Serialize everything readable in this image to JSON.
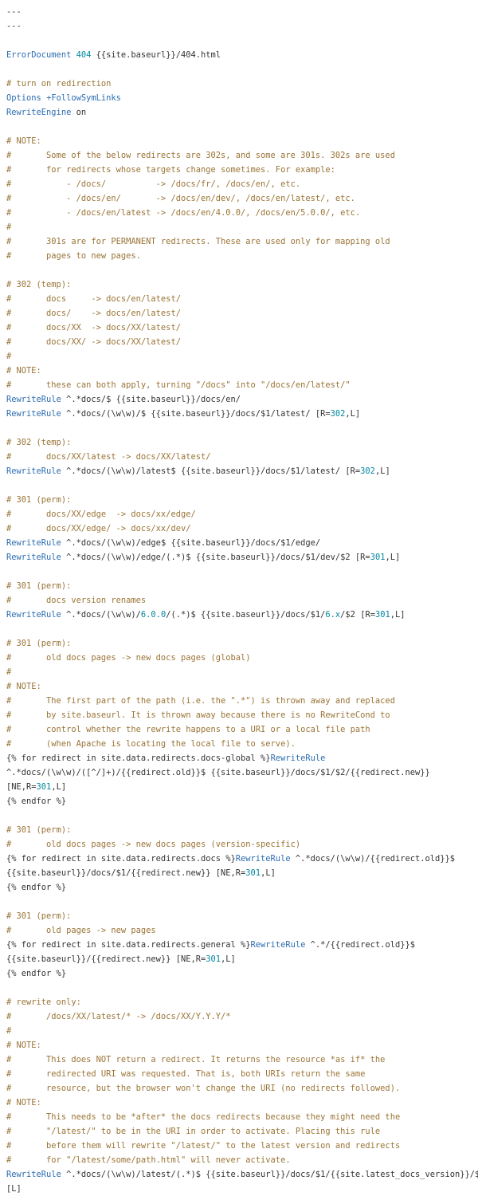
{
  "colors": {
    "background": "#ffffff",
    "plain": "#333333",
    "comment": "#9a7436",
    "keyword": "#2b6cb0",
    "number": "#00869e"
  },
  "lines": [
    [
      [
        "plain",
        "---"
      ]
    ],
    [
      [
        "plain",
        "---"
      ]
    ],
    [],
    [
      [
        "kw",
        "ErrorDocument"
      ],
      [
        "plain",
        " "
      ],
      [
        "num",
        "404"
      ],
      [
        "plain",
        " {{site.baseurl}}/404.html"
      ]
    ],
    [],
    [
      [
        "comment",
        "# turn on redirection"
      ]
    ],
    [
      [
        "kw",
        "Options"
      ],
      [
        "plain",
        " "
      ],
      [
        "kw",
        "+FollowSymLinks"
      ]
    ],
    [
      [
        "kw",
        "RewriteEngine"
      ],
      [
        "plain",
        " on"
      ]
    ],
    [],
    [
      [
        "comment",
        "# NOTE:"
      ]
    ],
    [
      [
        "comment",
        "#       Some of the below redirects are 302s, and some are 301s. 302s are used"
      ]
    ],
    [
      [
        "comment",
        "#       for redirects whose targets change sometimes. For example:"
      ]
    ],
    [
      [
        "comment",
        "#           - /docs/          -> /docs/fr/, /docs/en/, etc."
      ]
    ],
    [
      [
        "comment",
        "#           - /docs/en/       -> /docs/en/dev/, /docs/en/latest/, etc."
      ]
    ],
    [
      [
        "comment",
        "#           - /docs/en/latest -> /docs/en/4.0.0/, /docs/en/5.0.0/, etc."
      ]
    ],
    [
      [
        "comment",
        "#"
      ]
    ],
    [
      [
        "comment",
        "#       301s are for PERMANENT redirects. These are used only for mapping old"
      ]
    ],
    [
      [
        "comment",
        "#       pages to new pages."
      ]
    ],
    [],
    [
      [
        "comment",
        "# 302 (temp):"
      ]
    ],
    [
      [
        "comment",
        "#       docs     -> docs/en/latest/"
      ]
    ],
    [
      [
        "comment",
        "#       docs/    -> docs/en/latest/"
      ]
    ],
    [
      [
        "comment",
        "#       docs/XX  -> docs/XX/latest/"
      ]
    ],
    [
      [
        "comment",
        "#       docs/XX/ -> docs/XX/latest/"
      ]
    ],
    [
      [
        "comment",
        "#"
      ]
    ],
    [
      [
        "comment",
        "# NOTE:"
      ]
    ],
    [
      [
        "comment",
        "#       these can both apply, turning \"/docs\" into \"/docs/en/latest/\""
      ]
    ],
    [
      [
        "kw",
        "RewriteRule"
      ],
      [
        "plain",
        " ^.*docs/$ {{site.baseurl}}/docs/en/"
      ]
    ],
    [
      [
        "kw",
        "RewriteRule"
      ],
      [
        "plain",
        " ^.*docs/(\\w\\w)/$ {{site.baseurl}}/docs/$1/latest/ [R="
      ],
      [
        "num",
        "302"
      ],
      [
        "plain",
        ",L]"
      ]
    ],
    [],
    [
      [
        "comment",
        "# 302 (temp):"
      ]
    ],
    [
      [
        "comment",
        "#       docs/XX/latest -> docs/XX/latest/"
      ]
    ],
    [
      [
        "kw",
        "RewriteRule"
      ],
      [
        "plain",
        " ^.*docs/(\\w\\w)/latest$ {{site.baseurl}}/docs/$1/latest/ [R="
      ],
      [
        "num",
        "302"
      ],
      [
        "plain",
        ",L]"
      ]
    ],
    [],
    [
      [
        "comment",
        "# 301 (perm):"
      ]
    ],
    [
      [
        "comment",
        "#       docs/XX/edge  -> docs/xx/edge/"
      ]
    ],
    [
      [
        "comment",
        "#       docs/XX/edge/ -> docs/xx/dev/"
      ]
    ],
    [
      [
        "kw",
        "RewriteRule"
      ],
      [
        "plain",
        " ^.*docs/(\\w\\w)/edge$ {{site.baseurl}}/docs/$1/edge/"
      ]
    ],
    [
      [
        "kw",
        "RewriteRule"
      ],
      [
        "plain",
        " ^.*docs/(\\w\\w)/edge/(.*)$ {{site.baseurl}}/docs/$1/dev/$2 [R="
      ],
      [
        "num",
        "301"
      ],
      [
        "plain",
        ",L]"
      ]
    ],
    [],
    [
      [
        "comment",
        "# 301 (perm):"
      ]
    ],
    [
      [
        "comment",
        "#       docs version renames"
      ]
    ],
    [
      [
        "kw",
        "RewriteRule"
      ],
      [
        "plain",
        " ^.*docs/(\\w\\w)/"
      ],
      [
        "num",
        "6.0.0"
      ],
      [
        "plain",
        "/(.*)$ {{site.baseurl}}/docs/$1/"
      ],
      [
        "num",
        "6.x"
      ],
      [
        "plain",
        "/$2 [R="
      ],
      [
        "num",
        "301"
      ],
      [
        "plain",
        ",L]"
      ]
    ],
    [],
    [
      [
        "comment",
        "# 301 (perm):"
      ]
    ],
    [
      [
        "comment",
        "#       old docs pages -> new docs pages (global)"
      ]
    ],
    [
      [
        "comment",
        "#"
      ]
    ],
    [
      [
        "comment",
        "# NOTE:"
      ]
    ],
    [
      [
        "comment",
        "#       The first part of the path (i.e. the \".*\") is thrown away and replaced"
      ]
    ],
    [
      [
        "comment",
        "#       by site.baseurl. It is thrown away because there is no RewriteCond to"
      ]
    ],
    [
      [
        "comment",
        "#       control whether the rewrite happens to a URI or a local file path"
      ]
    ],
    [
      [
        "comment",
        "#       (when Apache is locating the local file to serve)."
      ]
    ],
    [
      [
        "plain",
        "{% for redirect in site.data.redirects.docs-global %}"
      ],
      [
        "kw",
        "RewriteRule"
      ]
    ],
    [
      [
        "plain",
        "^.*docs/(\\w\\w)/([^/]+)/{{redirect.old}}$ {{site.baseurl}}/docs/$1/$2/{{redirect.new}}"
      ]
    ],
    [
      [
        "plain",
        "[NE,R="
      ],
      [
        "num",
        "301"
      ],
      [
        "plain",
        ",L]"
      ]
    ],
    [
      [
        "plain",
        "{% endfor %}"
      ]
    ],
    [],
    [
      [
        "comment",
        "# 301 (perm):"
      ]
    ],
    [
      [
        "comment",
        "#       old docs pages -> new docs pages (version-specific)"
      ]
    ],
    [
      [
        "plain",
        "{% for redirect in site.data.redirects.docs %}"
      ],
      [
        "kw",
        "RewriteRule"
      ],
      [
        "plain",
        " ^.*docs/(\\w\\w)/{{redirect.old}}$"
      ]
    ],
    [
      [
        "plain",
        "{{site.baseurl}}/docs/$1/{{redirect.new}} [NE,R="
      ],
      [
        "num",
        "301"
      ],
      [
        "plain",
        ",L]"
      ]
    ],
    [
      [
        "plain",
        "{% endfor %}"
      ]
    ],
    [],
    [
      [
        "comment",
        "# 301 (perm):"
      ]
    ],
    [
      [
        "comment",
        "#       old pages -> new pages"
      ]
    ],
    [
      [
        "plain",
        "{% for redirect in site.data.redirects.general %}"
      ],
      [
        "kw",
        "RewriteRule"
      ],
      [
        "plain",
        " ^.*/{{redirect.old}}$"
      ]
    ],
    [
      [
        "plain",
        "{{site.baseurl}}/{{redirect.new}} [NE,R="
      ],
      [
        "num",
        "301"
      ],
      [
        "plain",
        ",L]"
      ]
    ],
    [
      [
        "plain",
        "{% endfor %}"
      ]
    ],
    [],
    [
      [
        "comment",
        "# rewrite only:"
      ]
    ],
    [
      [
        "comment",
        "#       /docs/XX/latest/* -> /docs/XX/Y.Y.Y/*"
      ]
    ],
    [
      [
        "comment",
        "#"
      ]
    ],
    [
      [
        "comment",
        "# NOTE:"
      ]
    ],
    [
      [
        "comment",
        "#       This does NOT return a redirect. It returns the resource *as if* the"
      ]
    ],
    [
      [
        "comment",
        "#       redirected URI was requested. That is, both URIs return the same"
      ]
    ],
    [
      [
        "comment",
        "#       resource, but the browser won't change the URI (no redirects followed)."
      ]
    ],
    [
      [
        "comment",
        "# NOTE:"
      ]
    ],
    [
      [
        "comment",
        "#       This needs to be *after* the docs redirects because they might need the"
      ]
    ],
    [
      [
        "comment",
        "#       \"/latest/\" to be in the URI in order to activate. Placing this rule"
      ]
    ],
    [
      [
        "comment",
        "#       before them will rewrite \"/latest/\" to the latest version and redirects"
      ]
    ],
    [
      [
        "comment",
        "#       for \"/latest/some/path.html\" will never activate."
      ]
    ],
    [
      [
        "kw",
        "RewriteRule"
      ],
      [
        "plain",
        " ^.*docs/(\\w\\w)/latest/(.*)$ {{site.baseurl}}/docs/$1/{{site.latest_docs_version}}/$2"
      ]
    ],
    [
      [
        "plain",
        "[L]"
      ]
    ]
  ]
}
